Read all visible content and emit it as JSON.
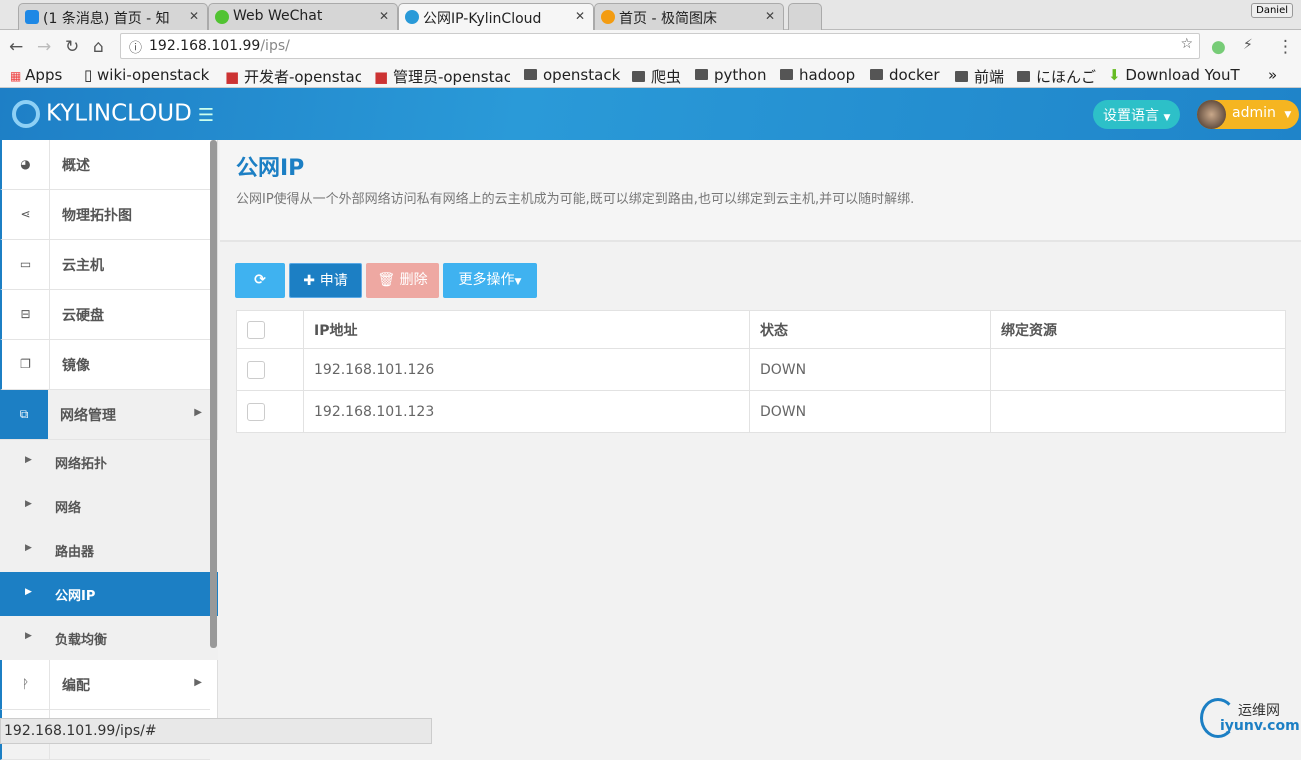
{
  "browser": {
    "tabs": [
      {
        "label": "(1 条消息) 首页 - 知",
        "color": "#1e88e5"
      },
      {
        "label": "Web WeChat",
        "color": "#51c332"
      },
      {
        "label": "公网IP-KylinCloud",
        "color": "#2a9ad8"
      },
      {
        "label": "首页 - 极简图床",
        "color": "#f39c12"
      }
    ],
    "profile": "Daniel",
    "url_host": "192.168.101.99",
    "url_path": "/ips/",
    "bookmarks": [
      "Apps",
      "wiki-openstack",
      "开发者-openstac",
      "管理员-openstac",
      "openstack",
      "爬虫",
      "python",
      "hadoop",
      "docker",
      "前端",
      "にほんご",
      "Download YouT"
    ],
    "more": "»"
  },
  "header": {
    "logo": "KYLINCLOUD",
    "lang": "设置语言",
    "user": "admin"
  },
  "sidebar": {
    "items": [
      {
        "label": "概述",
        "icon": "◕"
      },
      {
        "label": "物理拓扑图",
        "icon": "⋖"
      },
      {
        "label": "云主机",
        "icon": "▭"
      },
      {
        "label": "云硬盘",
        "icon": "⊟"
      },
      {
        "label": "镜像",
        "icon": "❐"
      },
      {
        "label": "网络管理",
        "icon": "⧉"
      },
      {
        "label": "编配",
        "icon": "ᚹ"
      }
    ],
    "sub": [
      {
        "label": "网络拓扑"
      },
      {
        "label": "网络"
      },
      {
        "label": "路由器"
      },
      {
        "label": "公网IP"
      },
      {
        "label": "负载均衡"
      }
    ]
  },
  "page": {
    "title": "公网IP",
    "desc": "公网IP使得从一个外部网络访问私有网络上的云主机成为可能,既可以绑定到路由,也可以绑定到云主机,并可以随时解绑."
  },
  "toolbar": {
    "refresh": "⟳",
    "apply": "申请",
    "delete": "删除",
    "more": "更多操作"
  },
  "table": {
    "headers": [
      "IP地址",
      "状态",
      "绑定资源"
    ],
    "rows": [
      {
        "ip": "192.168.101.126",
        "status": "DOWN",
        "resource": ""
      },
      {
        "ip": "192.168.101.123",
        "status": "DOWN",
        "resource": ""
      }
    ]
  },
  "statusbar": "192.168.101.99/ips/#",
  "watermark": {
    "a": "运维网",
    "b": "iyunv.com"
  }
}
